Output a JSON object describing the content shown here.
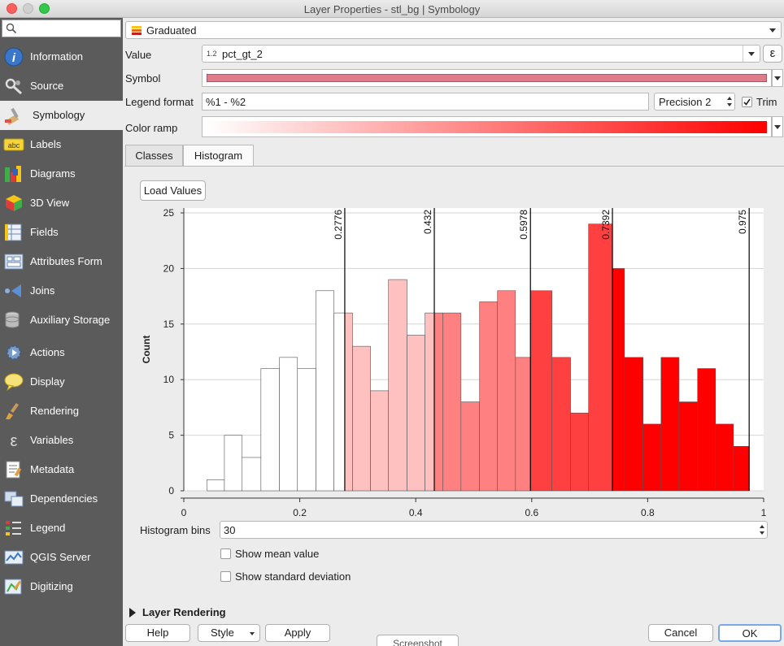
{
  "window": {
    "title": "Layer Properties - stl_bg | Symbology"
  },
  "sidebar": {
    "search_placeholder": "",
    "items": [
      {
        "label": "Information"
      },
      {
        "label": "Source"
      },
      {
        "label": "Symbology"
      },
      {
        "label": "Labels"
      },
      {
        "label": "Diagrams"
      },
      {
        "label": "3D View"
      },
      {
        "label": "Fields"
      },
      {
        "label": "Attributes Form"
      },
      {
        "label": "Joins"
      },
      {
        "label": "Auxiliary Storage"
      },
      {
        "label": "Actions"
      },
      {
        "label": "Display"
      },
      {
        "label": "Rendering"
      },
      {
        "label": "Variables"
      },
      {
        "label": "Metadata"
      },
      {
        "label": "Dependencies"
      },
      {
        "label": "Legend"
      },
      {
        "label": "QGIS Server"
      },
      {
        "label": "Digitizing"
      }
    ]
  },
  "renderer": {
    "type": "Graduated"
  },
  "value": {
    "label": "Value",
    "type_badge": "1.2",
    "field": "pct_gt_2",
    "expr_button": "ε"
  },
  "symbol": {
    "label": "Symbol",
    "color": "#e07b8a"
  },
  "legend_format": {
    "label": "Legend format",
    "value": "%1 - %2",
    "precision": "Precision 2",
    "trim_label": "Trim",
    "trim_checked": true
  },
  "color_ramp": {
    "label": "Color ramp",
    "from": "#ffffff",
    "to": "#ff0000"
  },
  "tabs": [
    {
      "label": "Classes"
    },
    {
      "label": "Histogram",
      "active": true
    }
  ],
  "load_values": "Load Values",
  "chart_data": {
    "type": "bar",
    "ylabel": "Count",
    "xlim": [
      0,
      1
    ],
    "ylim": [
      0,
      25
    ],
    "x_ticks": [
      "0",
      "0.2",
      "0.4",
      "0.6",
      "0.8",
      "1"
    ],
    "y_ticks": [
      "0",
      "5",
      "10",
      "15",
      "20",
      "25"
    ],
    "grid": true,
    "bins": [
      {
        "x0": 0.04,
        "x1": 0.07,
        "count": 1,
        "color": "#ffffff"
      },
      {
        "x0": 0.07,
        "x1": 0.1,
        "count": 5,
        "color": "#ffffff"
      },
      {
        "x0": 0.1,
        "x1": 0.133,
        "count": 3,
        "color": "#ffffff"
      },
      {
        "x0": 0.133,
        "x1": 0.165,
        "count": 11,
        "color": "#ffffff"
      },
      {
        "x0": 0.165,
        "x1": 0.196,
        "count": 12,
        "color": "#ffffff"
      },
      {
        "x0": 0.196,
        "x1": 0.228,
        "count": 11,
        "color": "#ffffff"
      },
      {
        "x0": 0.228,
        "x1": 0.259,
        "count": 18,
        "color": "#ffffff"
      },
      {
        "x0": 0.259,
        "x1": 0.2776,
        "count": 16,
        "color": "#ffffff"
      },
      {
        "x0": 0.2776,
        "x1": 0.291,
        "count": 16,
        "color": "#ffc0c0"
      },
      {
        "x0": 0.291,
        "x1": 0.322,
        "count": 13,
        "color": "#ffc0c0"
      },
      {
        "x0": 0.322,
        "x1": 0.353,
        "count": 9,
        "color": "#ffc0c0"
      },
      {
        "x0": 0.353,
        "x1": 0.385,
        "count": 19,
        "color": "#ffc0c0"
      },
      {
        "x0": 0.385,
        "x1": 0.416,
        "count": 14,
        "color": "#ffc0c0"
      },
      {
        "x0": 0.416,
        "x1": 0.432,
        "count": 16,
        "color": "#ffc0c0"
      },
      {
        "x0": 0.432,
        "x1": 0.447,
        "count": 16,
        "color": "#ff8080"
      },
      {
        "x0": 0.447,
        "x1": 0.478,
        "count": 16,
        "color": "#ff8080"
      },
      {
        "x0": 0.478,
        "x1": 0.51,
        "count": 8,
        "color": "#ff8080"
      },
      {
        "x0": 0.51,
        "x1": 0.541,
        "count": 17,
        "color": "#ff8080"
      },
      {
        "x0": 0.541,
        "x1": 0.572,
        "count": 18,
        "color": "#ff8080"
      },
      {
        "x0": 0.572,
        "x1": 0.5978,
        "count": 12,
        "color": "#ff8080"
      },
      {
        "x0": 0.5978,
        "x1": 0.635,
        "count": 18,
        "color": "#ff4040"
      },
      {
        "x0": 0.635,
        "x1": 0.667,
        "count": 12,
        "color": "#ff4040"
      },
      {
        "x0": 0.667,
        "x1": 0.698,
        "count": 7,
        "color": "#ff4040"
      },
      {
        "x0": 0.698,
        "x1": 0.7392,
        "count": 24,
        "color": "#ff4040"
      },
      {
        "x0": 0.7392,
        "x1": 0.76,
        "count": 20,
        "color": "#ff0000"
      },
      {
        "x0": 0.76,
        "x1": 0.792,
        "count": 12,
        "color": "#ff0000"
      },
      {
        "x0": 0.792,
        "x1": 0.823,
        "count": 6,
        "color": "#ff0000"
      },
      {
        "x0": 0.823,
        "x1": 0.854,
        "count": 12,
        "color": "#ff0000"
      },
      {
        "x0": 0.854,
        "x1": 0.886,
        "count": 8,
        "color": "#ff0000"
      },
      {
        "x0": 0.886,
        "x1": 0.917,
        "count": 11,
        "color": "#ff0000"
      },
      {
        "x0": 0.917,
        "x1": 0.948,
        "count": 6,
        "color": "#ff0000"
      },
      {
        "x0": 0.948,
        "x1": 0.975,
        "count": 4,
        "color": "#ff0000"
      }
    ],
    "breaks": [
      {
        "x": 0.2776,
        "label": "0.2776"
      },
      {
        "x": 0.432,
        "label": "0.432"
      },
      {
        "x": 0.5978,
        "label": "0.5978"
      },
      {
        "x": 0.7392,
        "label": "0.7392"
      },
      {
        "x": 0.975,
        "label": "0.975"
      }
    ]
  },
  "histogram_bins": {
    "label": "Histogram bins",
    "value": "30"
  },
  "show_mean": {
    "label": "Show mean value",
    "checked": false
  },
  "show_stddev": {
    "label": "Show standard deviation",
    "checked": false
  },
  "layer_rendering": {
    "label": "Layer Rendering"
  },
  "buttons": {
    "help": "Help",
    "style": "Style",
    "apply": "Apply",
    "cancel": "Cancel",
    "ok": "OK",
    "screenshot": "Screenshot"
  }
}
